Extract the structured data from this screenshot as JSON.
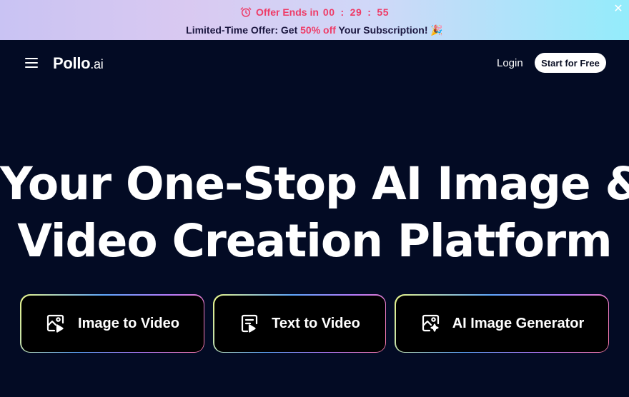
{
  "promo": {
    "timer_label": "Offer Ends in",
    "timer": {
      "hours": "00",
      "minutes": "29",
      "seconds": "55",
      "separator": ":"
    },
    "offer_prefix": "Limited-Time Offer: Get ",
    "offer_highlight": "50% off",
    "offer_suffix": " Your Subscription! 🎉",
    "close_glyph": "✕"
  },
  "nav": {
    "logo_main": "Pollo",
    "logo_suffix": ".ai",
    "login": "Login",
    "start": "Start for Free"
  },
  "hero": {
    "line1": "Your One-Stop AI Image &",
    "line2": "Video Creation Platform"
  },
  "features": [
    {
      "label": "Image to Video",
      "icon": "image-to-video-icon"
    },
    {
      "label": "Text to Video",
      "icon": "text-to-video-icon"
    },
    {
      "label": "AI Image Generator",
      "icon": "ai-image-generator-icon"
    }
  ],
  "colors": {
    "background": "#030b24",
    "accent": "#ee3b67",
    "text": "#ffffff"
  }
}
